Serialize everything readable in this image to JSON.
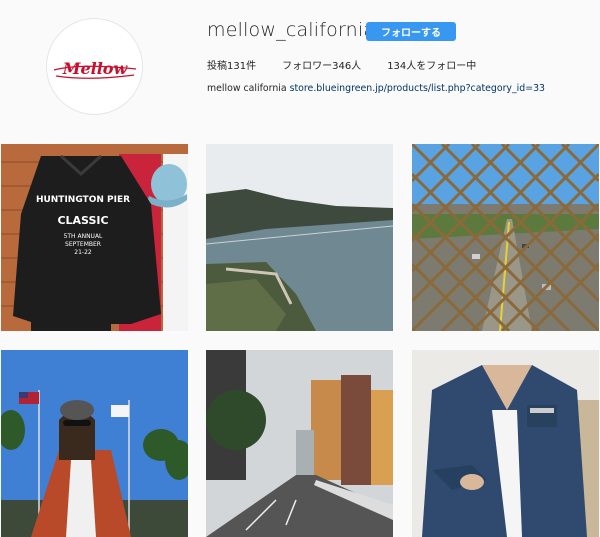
{
  "profile": {
    "username": "mellow_california",
    "follow_label": "フォローする",
    "logo_text": "Mellow",
    "stats": {
      "posts": "投稿131件",
      "followers": "フォロワー346人",
      "following": "134人をフォロー中"
    },
    "bio_name": "mellow california",
    "bio_link": "store.blueingreen.jp/products/list.php?category_id=33"
  },
  "jacket_print": {
    "line1": "HUNTINGTON PIER",
    "line2": "CLASSIC",
    "line3": "5TH ANNUAL",
    "line4": "SEPTEMBER",
    "line5": "21-22"
  },
  "colors": {
    "accent": "#3897f0",
    "logo_red": "#c8102e"
  }
}
